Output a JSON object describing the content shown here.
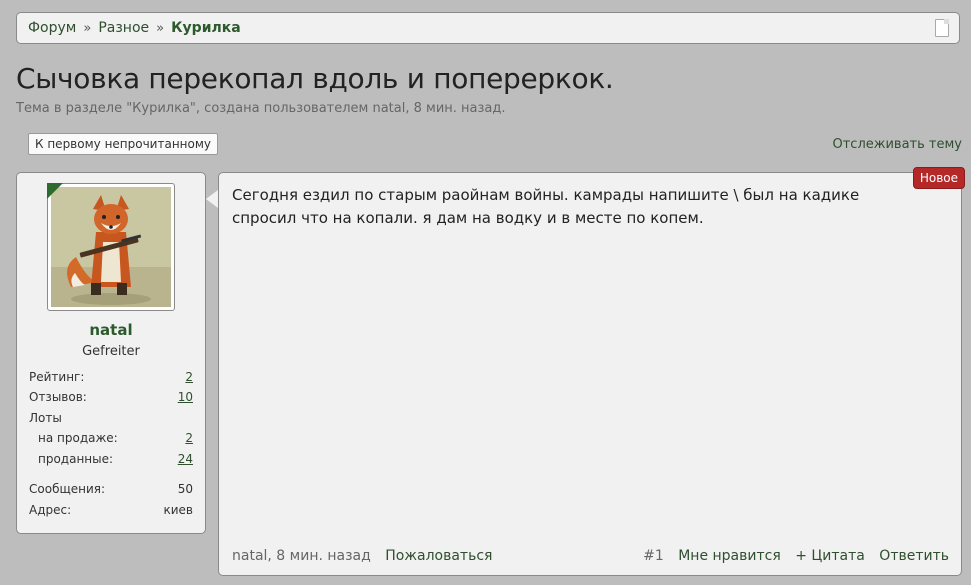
{
  "breadcrumb": {
    "items": [
      "Форум",
      "Разное",
      "Курилка"
    ],
    "separator": "»"
  },
  "thread": {
    "title": "Сычовка перекопал вдоль и поперерко​к.",
    "subtitle": "Тема в разделе \"Курилка\", создана пользователем natal, 8 мин. назад."
  },
  "controls": {
    "first_unread": "К первому непрочитанному",
    "watch": "Отслеживать тему"
  },
  "user": {
    "name": "natal",
    "title": "Gefreiter",
    "stats": {
      "rating_label": "Рейтинг:",
      "rating_value": "2",
      "reviews_label": "Отзывов:",
      "reviews_value": "10",
      "lots_label": "Лоты",
      "for_sale_label": "на продаже:",
      "for_sale_value": "2",
      "sold_label": "проданные:",
      "sold_value": "24",
      "messages_label": "Сообщения:",
      "messages_value": "50",
      "address_label": "Адрес:",
      "address_value": "киев"
    }
  },
  "post": {
    "badge": "Новое",
    "message": "Сегодня ездил по старым раойнам войны. камрады напишите \\ был на кадике\nспросил что на копали. я дам на водку и в месте по копем.",
    "meta": "natal, 8 мин. назад",
    "report": "Пожаловаться",
    "number": "#1",
    "like": "Мне нравится",
    "quote": "+ Цитата",
    "reply": "Ответить"
  },
  "colors": {
    "background": "#bdbdbd",
    "panel": "#f1f1f1",
    "accent_green": "#2f4f2f",
    "badge_red": "#b52828"
  }
}
